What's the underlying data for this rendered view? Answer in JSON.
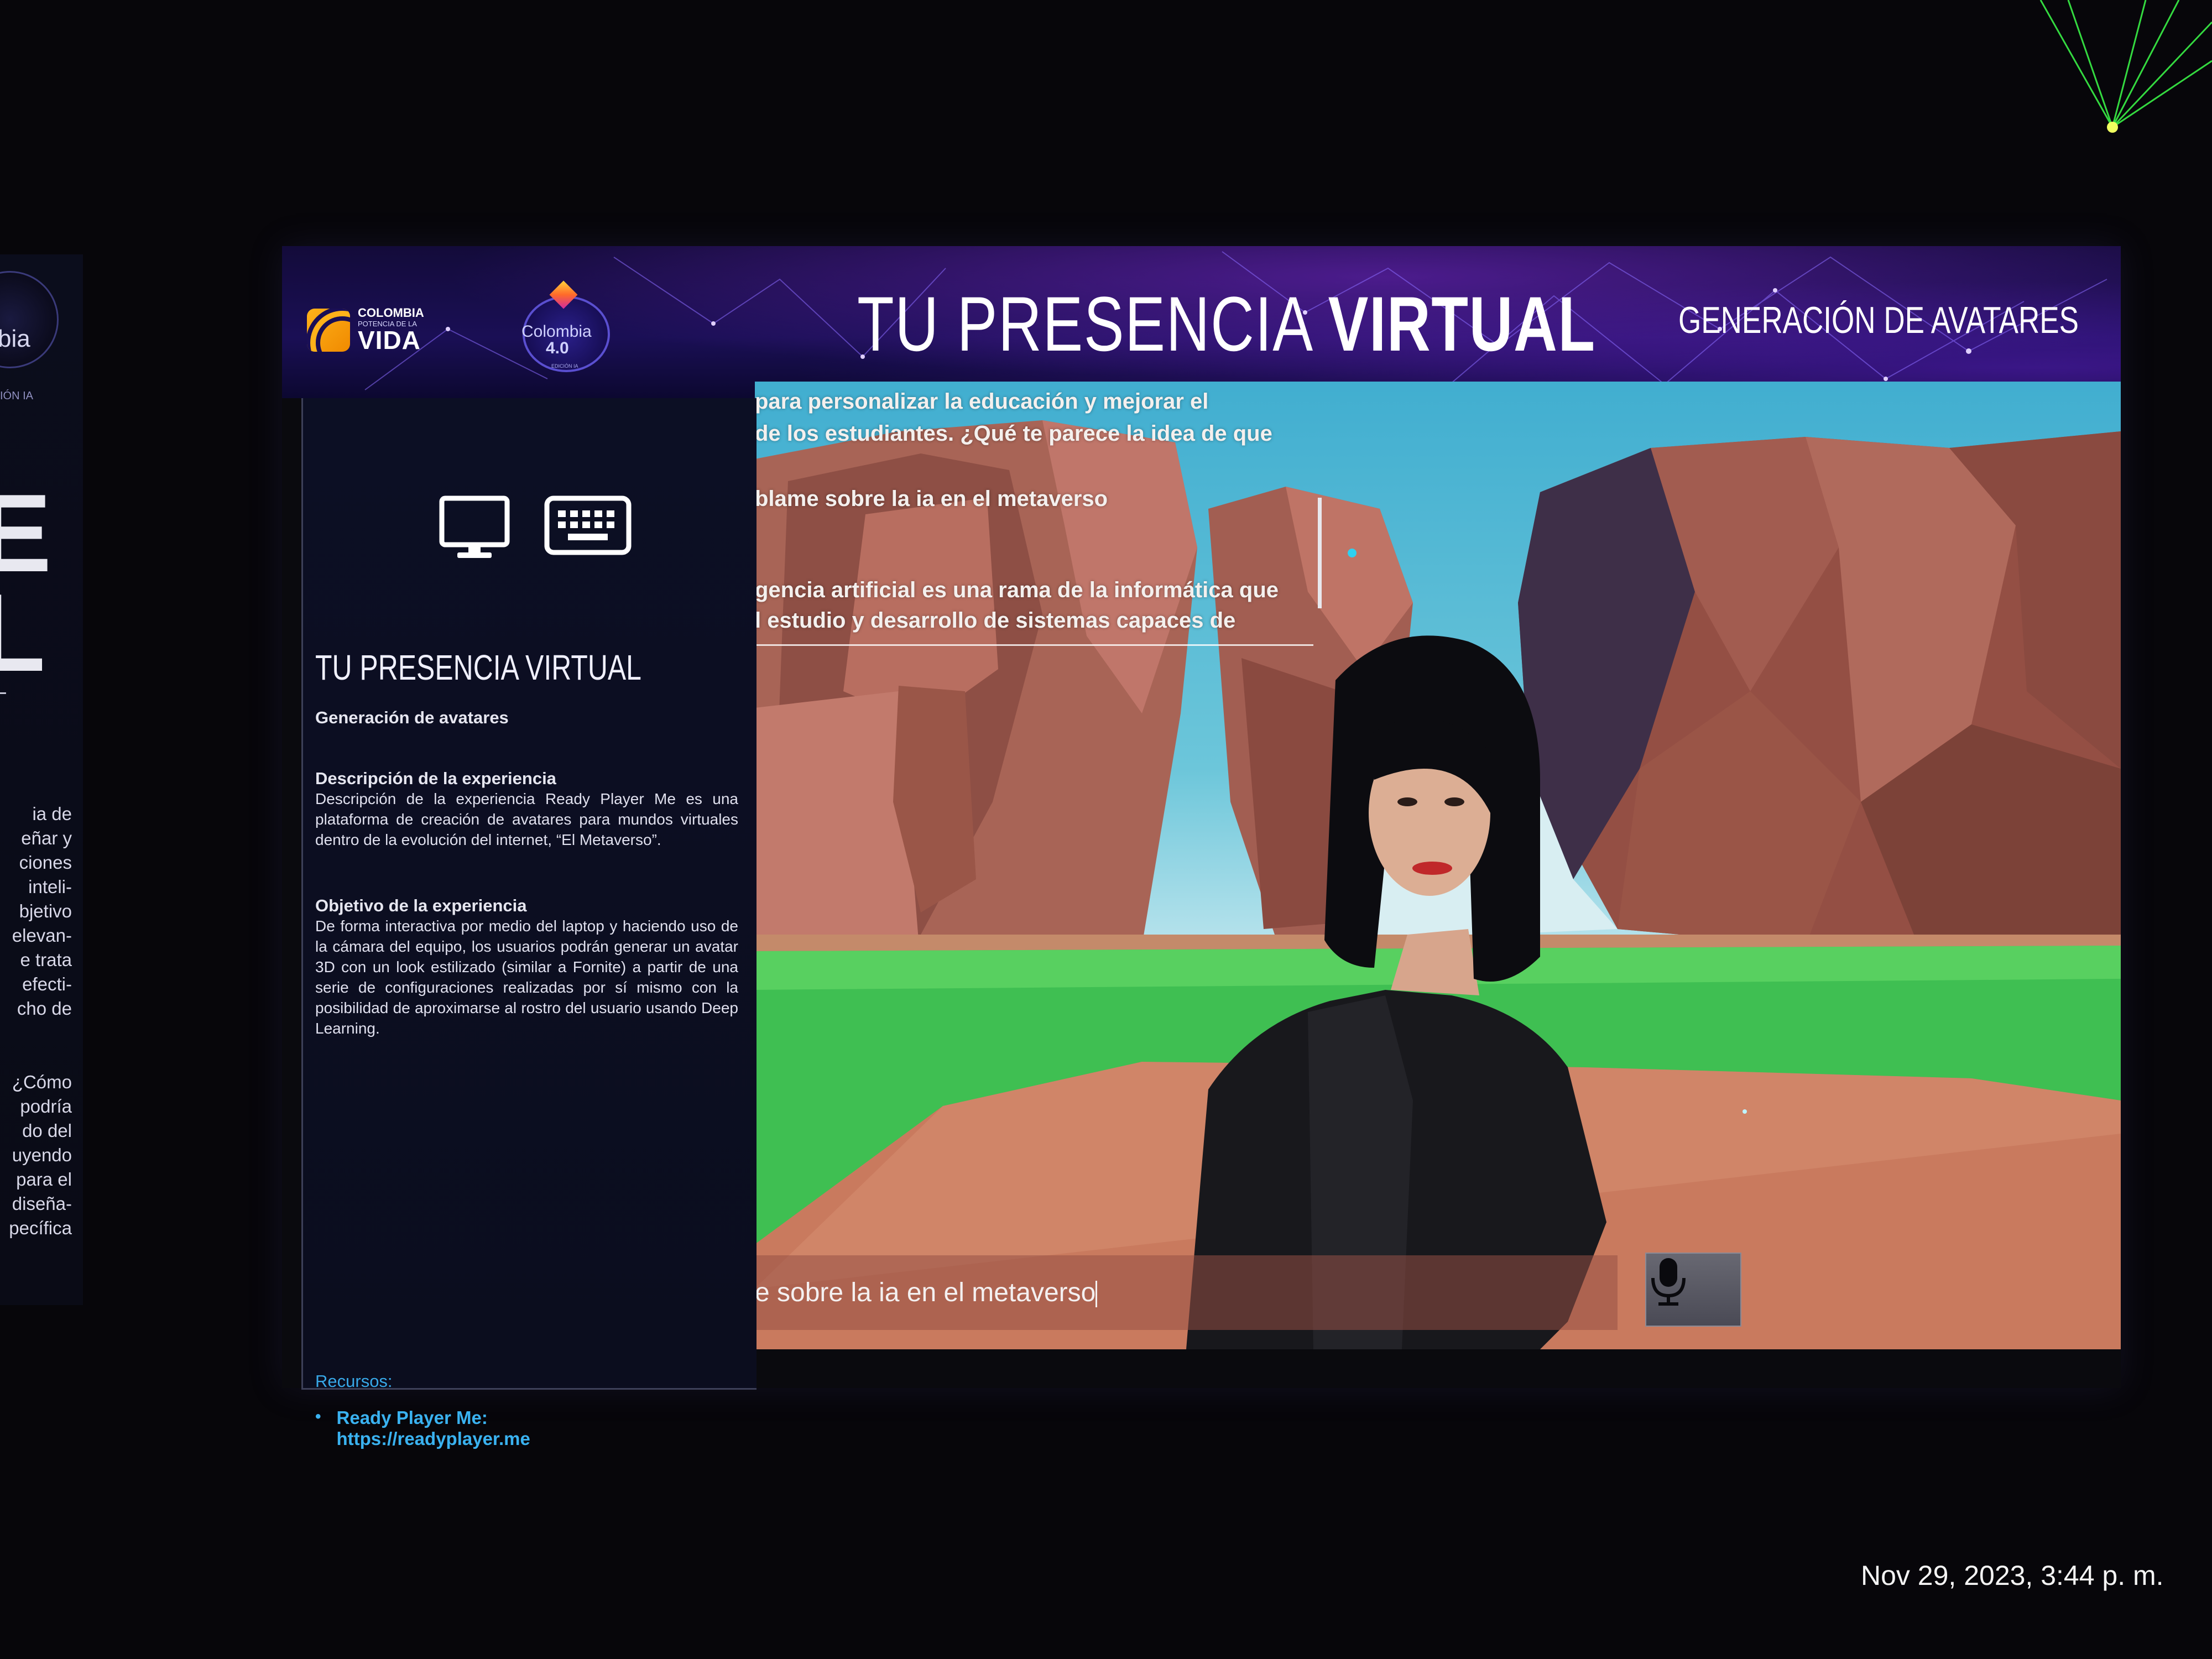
{
  "left_screen": {
    "logo_text": "bia",
    "logo_sub": "IÓN IA",
    "big_letters": [
      "E",
      "L"
    ],
    "small_letter": "L",
    "paragraph_1": [
      "ia de",
      "eñar y",
      "ciones",
      "inteli-",
      "bjetivo",
      "elevan-",
      "e trata",
      "efecti-",
      "cho de"
    ],
    "paragraph_2": [
      "¿Cómo",
      "podría",
      "do del",
      "uyendo",
      "para el",
      "diseña-",
      "pecífica"
    ]
  },
  "header": {
    "brand_colombia": {
      "line1": "COLOMBIA",
      "line2": "POTENCIA DE LA",
      "line3": "VIDA"
    },
    "brand_40": {
      "name": "Colombia",
      "number": "4.0",
      "sub": "EDICIÓN IA"
    },
    "title_regular": "TU PRESENCIA ",
    "title_bold": "VIRTUAL",
    "subtitle": "GENERACIÓN DE AVATARES"
  },
  "panel": {
    "icons": [
      "monitor-icon",
      "keyboard-icon"
    ],
    "title": "TU PRESENCIA VIRTUAL",
    "subtitle": "Generación de avatares",
    "description_heading": "Descripción de la experiencia",
    "description_body": "Descripción de la experiencia Ready Player Me es una plataforma de creación de avatares para mundos virtuales dentro de la evolución del internet, “El Metaverso”.",
    "objective_heading": "Objetivo de la experiencia",
    "objective_body": "De forma interactiva por medio del laptop y haciendo uso de la cámara del equipo, los usuarios podrán generar un avatar 3D con un look estilizado (similar a Fornite) a partir de una serie de configuraciones realizadas por sí mismo con la posibilidad de aproximarse al rostro del usuario usando Deep Learning.",
    "resources_label": "Recursos:",
    "resource_name": "Ready Player Me:",
    "resource_url": "https://readyplayer.me"
  },
  "chat": {
    "lines": [
      "para personalizar la educación y mejorar el",
      "de los estudiantes. ¿Qué te parece la idea de que",
      "blame sobre la ia en el metaverso",
      "gencia artificial es una rama de la informática que",
      "l estudio y desarrollo de sistemas capaces de"
    ],
    "input_value": "e sobre la ia en el metaverso",
    "mic_icon": "microphone-icon"
  },
  "colors": {
    "header_bg": "#1a0f55",
    "panel_bg": "#0c0f24",
    "resource_link": "#3ab2f0",
    "brand_orange": "#f5a000"
  },
  "timestamp": "Nov 29, 2023, 3:44 p. m."
}
